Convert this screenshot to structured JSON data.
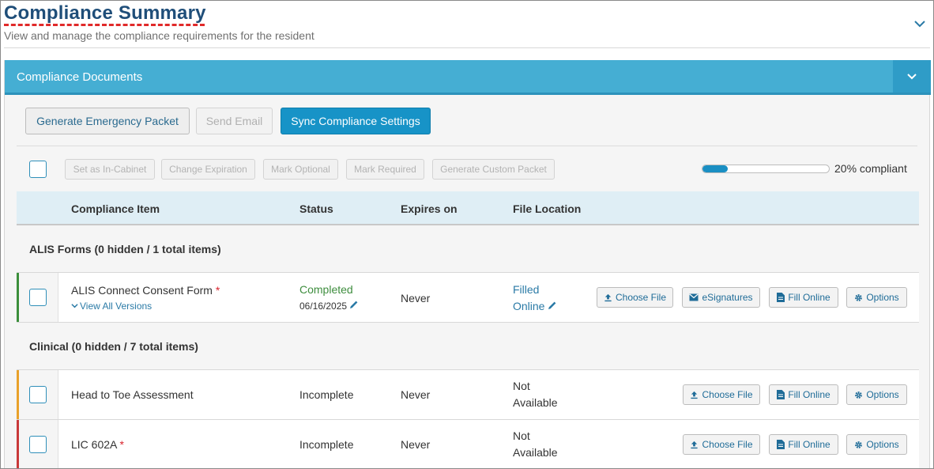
{
  "header": {
    "title": "Compliance Summary",
    "subtitle": "View and manage the compliance requirements for the resident"
  },
  "panel": {
    "title": "Compliance Documents"
  },
  "toolbar": {
    "generate_emergency_packet": "Generate Emergency Packet",
    "send_email": "Send Email",
    "sync_compliance_settings": "Sync Compliance Settings"
  },
  "selection_toolbar": {
    "set_in_cabinet": "Set as In-Cabinet",
    "change_expiration": "Change Expiration",
    "mark_optional": "Mark Optional",
    "mark_required": "Mark Required",
    "generate_custom_packet": "Generate Custom Packet"
  },
  "progress": {
    "percent": 20,
    "label": "20% compliant"
  },
  "columns": {
    "item": "Compliance Item",
    "status": "Status",
    "expires": "Expires on",
    "location": "File Location"
  },
  "groups": [
    {
      "label": "ALIS Forms  (0 hidden / 1 total items)",
      "items": [
        {
          "name": "ALIS Connect Consent Form",
          "required_mark": "*",
          "versions_link": "View All Versions",
          "status": "Completed",
          "status_date": "06/16/2025",
          "expires": "Never",
          "location_line1": "Filled",
          "location_line2": "Online",
          "accent_color": "#3b8f3b",
          "actions": [
            "Choose File",
            "eSignatures",
            "Fill Online",
            "Options"
          ]
        }
      ]
    },
    {
      "label": "Clinical (0 hidden / 7 total items)",
      "items": [
        {
          "name": "Head to Toe Assessment",
          "required_mark": "",
          "status": "Incomplete",
          "expires": "Never",
          "location_line1": "Not",
          "location_line2": "Available",
          "accent_color": "#e9a12a",
          "actions": [
            "Choose File",
            "Fill Online",
            "Options"
          ]
        },
        {
          "name": "LIC 602A",
          "required_mark": "*",
          "status": "Incomplete",
          "expires": "Never",
          "location_line1": "Not",
          "location_line2": "Available",
          "accent_color": "#c9393a",
          "actions": [
            "Choose File",
            "Fill Online",
            "Options"
          ]
        }
      ]
    }
  ],
  "icons": {
    "collapse": "chevron-down-icon",
    "upload": "upload-icon",
    "envelope": "envelope-icon",
    "document": "document-icon",
    "gear": "gear-icon",
    "pencil": "pencil-icon"
  }
}
